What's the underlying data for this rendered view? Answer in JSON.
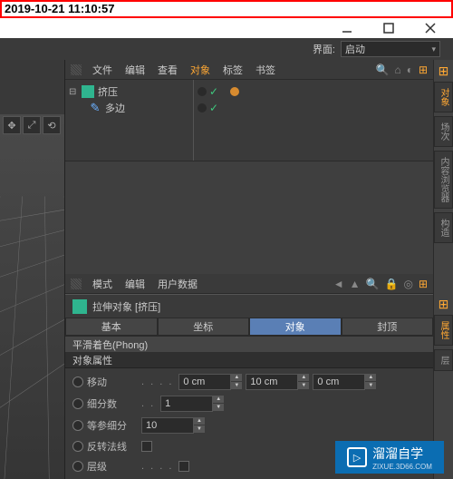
{
  "timestamp": "2019-10-21 11:10:57",
  "interface": {
    "label": "界面:",
    "value": "启动"
  },
  "obj_panel": {
    "menu": [
      "文件",
      "编辑",
      "查看",
      "对象",
      "标签",
      "书签"
    ],
    "highlight_index": 3,
    "tree": [
      {
        "name": "挤压",
        "icon": "extrude"
      },
      {
        "name": "多边",
        "icon": "poly"
      }
    ]
  },
  "attr_panel": {
    "menu": [
      "模式",
      "编辑",
      "用户数据"
    ],
    "title": "拉伸对象 [挤压]",
    "tabs": [
      "基本",
      "坐标",
      "对象",
      "封顶"
    ],
    "active_tab": 2,
    "subtab": "平滑着色(Phong)",
    "section": "对象属性",
    "rows": {
      "move": {
        "label": "移动",
        "v1": "0 cm",
        "v2": "10 cm",
        "v3": "0 cm"
      },
      "subdiv": {
        "label": "细分数",
        "v": "1"
      },
      "isoparm": {
        "label": "等参细分",
        "v": "10"
      },
      "flip": {
        "label": "反转法线"
      },
      "hierarchy": {
        "label": "层级"
      }
    }
  },
  "right_tabs": [
    "对象",
    "场次",
    "内容浏览器",
    "构造"
  ],
  "right_tabs2": [
    "属性",
    "层"
  ],
  "watermark": {
    "main": "溜溜自学",
    "sub": "ZIXUE.3D66.COM"
  }
}
